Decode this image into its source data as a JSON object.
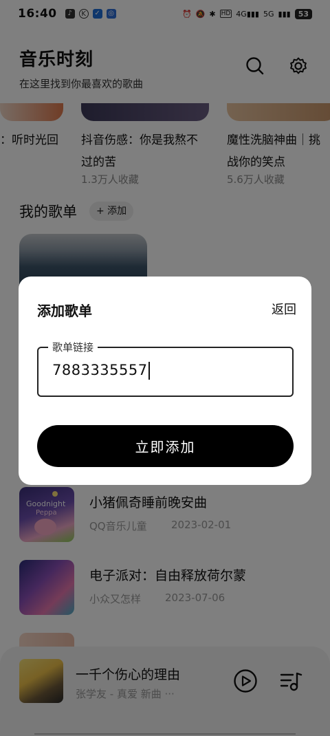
{
  "status_bar": {
    "time": "16:40",
    "network": "5G",
    "battery": "53"
  },
  "header": {
    "title": "音乐时刻",
    "subtitle": "在这里找到你最喜欢的歌曲"
  },
  "icons": {
    "search": "search-icon",
    "settings": "gear-icon"
  },
  "cards": [
    {
      "title": "：听时光回",
      "meta": ""
    },
    {
      "title": "抖音伤感：你是我熬不过的苦",
      "meta": "1.3万人收藏"
    },
    {
      "title": "魔性洗脑神曲｜挑战你的笑点",
      "meta": "5.6万人收藏"
    }
  ],
  "my_playlists": {
    "title": "我的歌单",
    "add_label": "+ 添加"
  },
  "list": [
    {
      "title": "小猪佩奇睡前晚安曲",
      "source": "QQ音乐儿童",
      "date": "2023-02-01"
    },
    {
      "title": "电子派对：自由释放荷尔蒙",
      "source": "小众又怎样",
      "date": "2023-07-06"
    }
  ],
  "mini_player": {
    "title": "一千个伤心的理由",
    "subtitle": "张学友 - 真爱 新曲 ···"
  },
  "dialog": {
    "title": "添加歌单",
    "back_label": "返回",
    "field_label": "歌单链接",
    "field_value": "7883335557",
    "submit_label": "立即添加"
  }
}
